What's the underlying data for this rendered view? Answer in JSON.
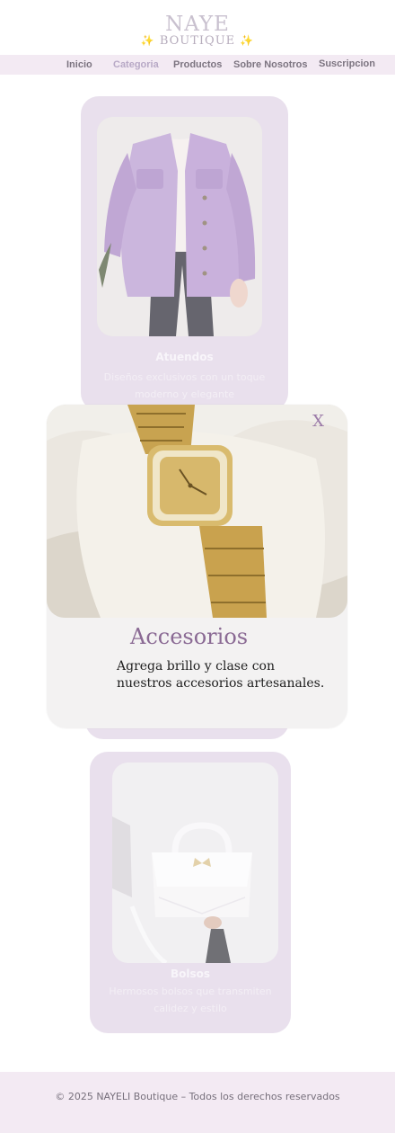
{
  "brand": {
    "name": "NAYE",
    "subtitle": "BOUTIQUE",
    "sparkle": "✨"
  },
  "nav": {
    "items": [
      {
        "label": "Inicio"
      },
      {
        "label": "Categoria"
      },
      {
        "label": "Productos"
      },
      {
        "label": "Sobre Nosotros"
      },
      {
        "label": "Suscripcion"
      }
    ],
    "active": "Categoria"
  },
  "categories": [
    {
      "title": "Atuendos",
      "description": "Diseños exclusivos con un toque moderno y elegante",
      "image": "purple-jacket-photo"
    },
    {
      "title": "Accesorios",
      "description": "Agrega brillo y clase con nuestros accesorios artesanales.",
      "image": "gold-watch-photo"
    },
    {
      "title": "Bolsos",
      "description": "Hermosos bolsos que transmiten calidez y estilo",
      "image": "white-handbag-photo"
    }
  ],
  "modal": {
    "close_label": "X",
    "title": "Accesorios",
    "text": "Agrega brillo y clase con nuestros accesorios artesanales.",
    "image": "gold-watch-photo"
  },
  "footer": {
    "text": "© 2025 NAYELI Boutique – Todos los derechos reservados"
  },
  "colors": {
    "accent": "#8a6a94",
    "card_bg": "#e1d5e6",
    "nav_bg": "#f3eaf3"
  }
}
